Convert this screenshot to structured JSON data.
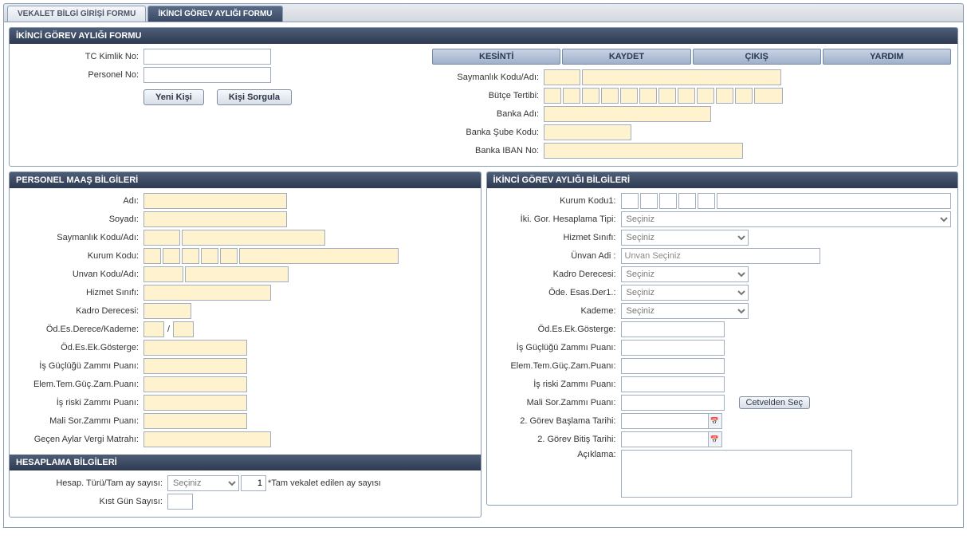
{
  "tabs": {
    "vekalet": "VEKALET BİLGİ GİRİŞİ FORMU",
    "ikinci": "İKİNCİ GÖREV AYLIĞI FORMU"
  },
  "formHeader": "İKİNCİ GÖREV AYLIĞI FORMU",
  "topLeft": {
    "tcKimlikLabel": "TC Kimlik No:",
    "personelNoLabel": "Personel No:",
    "yeniKisiBtn": "Yeni Kişi",
    "kisiSorgulaBtn": "Kişi Sorgula"
  },
  "toolbar": {
    "kesinti": "KESİNTİ",
    "kaydet": "KAYDET",
    "cikis": "ÇIKIŞ",
    "yardim": "YARDIM"
  },
  "topRight": {
    "saymanlikLabel": "Saymanlık Kodu/Adı:",
    "butceLabel": "Bütçe Tertibi:",
    "bankaAdiLabel": "Banka Adı:",
    "bankaSubeLabel": "Banka Şube Kodu:",
    "bankaIbanLabel": "Banka IBAN No:"
  },
  "personelHeader": "PERSONEL MAAŞ BİLGİLERİ",
  "personel": {
    "adiLabel": "Adı:",
    "soyadiLabel": "Soyadı:",
    "saymanlikLabel": "Saymanlık Kodu/Adı:",
    "kurumLabel": "Kurum Kodu:",
    "unvanLabel": "Unvan Kodu/Adı:",
    "hizmetLabel": "Hizmet Sınıfı:",
    "kadroLabel": "Kadro Derecesi:",
    "odEsLabel": "Öd.Es.Derece/Kademe:",
    "slash": "/",
    "ekGostergeLabel": "Öd.Es.Ek.Gösterge:",
    "isGucluguLabel": "İş Güçlüğü Zammı Puanı:",
    "elemTemLabel": "Elem.Tem.Güç.Zam.Puanı:",
    "isRiskiLabel": "İş riski Zammı Puanı:",
    "maliSorLabel": "Mali Sor.Zammı Puanı:",
    "gecenAylarLabel": "Geçen Aylar Vergi Matrahı:"
  },
  "hesaplamaHeader": "HESAPLAMA BİLGİLERİ",
  "hesaplama": {
    "turuLabel": "Hesap. Türü/Tam ay sayısı:",
    "secinizOption": "Seçiniz",
    "tamAyValue": "1",
    "tamAyNote": "*Tam vekalet edilen ay sayısı",
    "kistGunLabel": "Kıst Gün Sayısı:"
  },
  "ikinciHeader": "İKİNCİ GÖREV AYLIĞI BİLGİLERİ",
  "ikinci": {
    "kurumKoduLabel": "Kurum Kodu1:",
    "ikiGorLabel": "İki. Gor. Hesaplama Tipi:",
    "hizmetLabel": "Hizmet Sınıfı:",
    "unvanLabel": "Ünvan Adi :",
    "unvanPlaceholder": "Unvan Seçiniz",
    "kadroLabel": "Kadro Derecesi:",
    "odeLabel": "Öde. Esas.Der1.:",
    "kademeLabel": "Kademe:",
    "ekGostergeLabel": "Öd.Es.Ek.Gösterge:",
    "isGucluguLabel": "İş Güçlüğü Zammı Puanı:",
    "elemTemLabel": "Elem.Tem.Güç.Zam.Puanı:",
    "isRiskiLabel": "İş riski Zammı Puanı:",
    "maliSorLabel": "Mali Sor.Zammı Puanı:",
    "cetveldenBtn": "Cetvelden Seç",
    "baslamaLabel": "2. Görev Başlama Tarihi:",
    "bitisLabel": "2. Görev Bitiş Tarihi:",
    "aciklamaLabel": "Açıklama:",
    "secinizOption": "Seçiniz"
  }
}
